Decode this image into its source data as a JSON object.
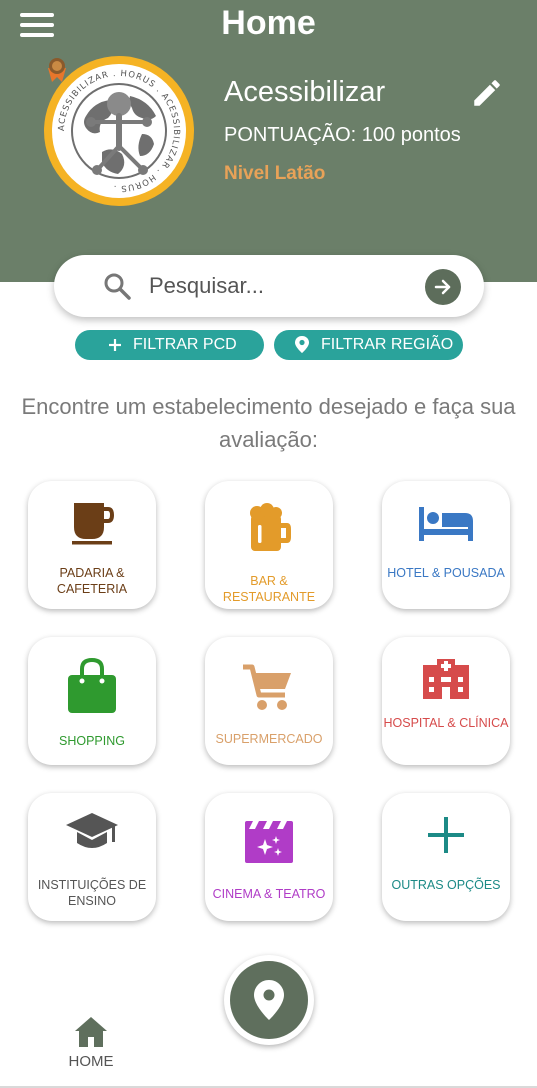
{
  "header": {
    "title": "Home",
    "menu_icon": "hamburger-menu-icon",
    "background_color": "#6b7f69"
  },
  "profile": {
    "name": "Acessibilizar",
    "score": "PONTUAÇÃO: 100 pontos",
    "level": "Nivel Latão",
    "level_color": "#e8a258",
    "logo_ring_text": "ACESSIBILIZAR . HORUS . ACESSIBILIZAR . HORUS .",
    "edit_icon": "pencil-icon"
  },
  "search": {
    "placeholder": "Pesquisar...",
    "icon": "search-icon",
    "submit_icon": "arrow-right-icon"
  },
  "filters": {
    "pcd_label": "FILTRAR PCD",
    "region_label": "FILTRAR REGIÃO",
    "color": "#2aa39b"
  },
  "intro_text": "Encontre um estabelecimento desejado e faça sua avaliação:",
  "categories": [
    {
      "label": "PADARIA & CAFETERIA",
      "icon": "coffee-cup-icon",
      "color": "#6b3e17"
    },
    {
      "label": "BAR & RESTAURANTE",
      "icon": "beer-mug-icon",
      "color": "#e39b2a"
    },
    {
      "label": "HOTEL & POUSADA",
      "icon": "hotel-bed-icon",
      "color": "#3a78c4"
    },
    {
      "label": "SHOPPING",
      "icon": "shopping-bag-icon",
      "color": "#2f9a2f"
    },
    {
      "label": "SUPERMERCADO",
      "icon": "shopping-cart-icon",
      "color": "#d9a06a"
    },
    {
      "label": "HOSPITAL & CLÍNICA",
      "icon": "hospital-icon",
      "color": "#d64b4b"
    },
    {
      "label": "INSTITUIÇÕES DE ENSINO",
      "icon": "graduation-cap-icon",
      "color": "#555555"
    },
    {
      "label": "CINEMA & TEATRO",
      "icon": "movie-clapper-icon",
      "color": "#b03cc7"
    },
    {
      "label": "OUTRAS OPÇÕES",
      "icon": "plus-icon",
      "color": "#1c8a86"
    }
  ],
  "bottom_nav": {
    "home_label": "HOME",
    "home_icon": "home-icon",
    "map_button_icon": "location-pin-icon"
  }
}
